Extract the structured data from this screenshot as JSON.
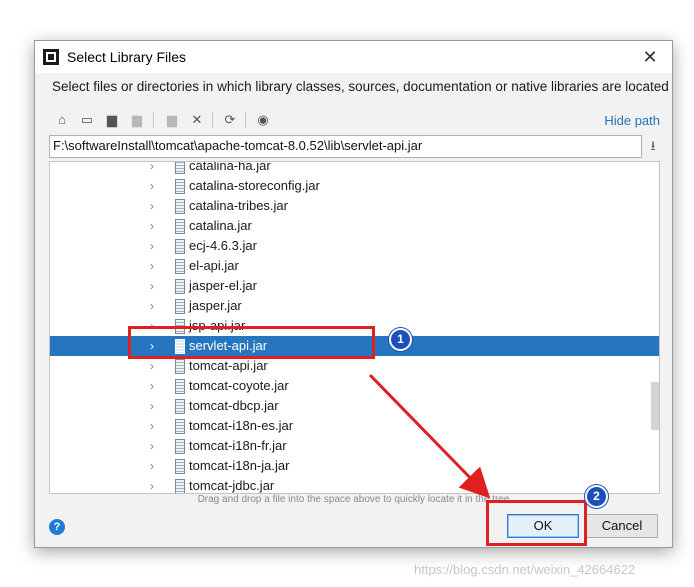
{
  "dialog": {
    "title": "Select Library Files",
    "close_glyph": "✕",
    "description": "Select files or directories in which library classes, sources, documentation or native libraries are located",
    "hide_path": "Hide path",
    "path": "F:\\softwareInstall\\tomcat\\apache-tomcat-8.0.52\\lib\\servlet-api.jar",
    "drag_hint": "Drag and drop a file into the space above to quickly locate it in the tree",
    "help_glyph": "?",
    "ok_label": "OK",
    "cancel_label": "Cancel"
  },
  "toolbar": [
    {
      "icon": "home-icon",
      "glyph": "⌂",
      "enabled": true
    },
    {
      "icon": "desktop-icon",
      "glyph": "▭",
      "enabled": true
    },
    {
      "icon": "project-folder-icon",
      "glyph": "▆",
      "enabled": true
    },
    {
      "icon": "module-folder-icon",
      "glyph": "▆",
      "enabled": false
    },
    {
      "icon": "new-folder-icon",
      "glyph": "▆",
      "enabled": false
    },
    {
      "icon": "delete-icon",
      "glyph": "✕",
      "enabled": true
    },
    {
      "icon": "refresh-icon",
      "glyph": "⟳",
      "enabled": true
    },
    {
      "icon": "show-hidden-icon",
      "glyph": "◉",
      "enabled": true
    }
  ],
  "tree": {
    "selected_index": 9,
    "items": [
      "catalina-ha.jar",
      "catalina-storeconfig.jar",
      "catalina-tribes.jar",
      "catalina.jar",
      "ecj-4.6.3.jar",
      "el-api.jar",
      "jasper-el.jar",
      "jasper.jar",
      "jsp-api.jar",
      "servlet-api.jar",
      "tomcat-api.jar",
      "tomcat-coyote.jar",
      "tomcat-dbcp.jar",
      "tomcat-i18n-es.jar",
      "tomcat-i18n-fr.jar",
      "tomcat-i18n-ja.jar",
      "tomcat-jdbc.jar"
    ]
  },
  "annotations": {
    "badge_1": "1",
    "badge_2": "2",
    "highlight_color": "#e02020",
    "badge_color": "#1c4fb8"
  },
  "watermark": "https://blog.csdn.net/weixin_42664622",
  "colors": {
    "selection": "#2675bf",
    "link": "#2470b3"
  }
}
